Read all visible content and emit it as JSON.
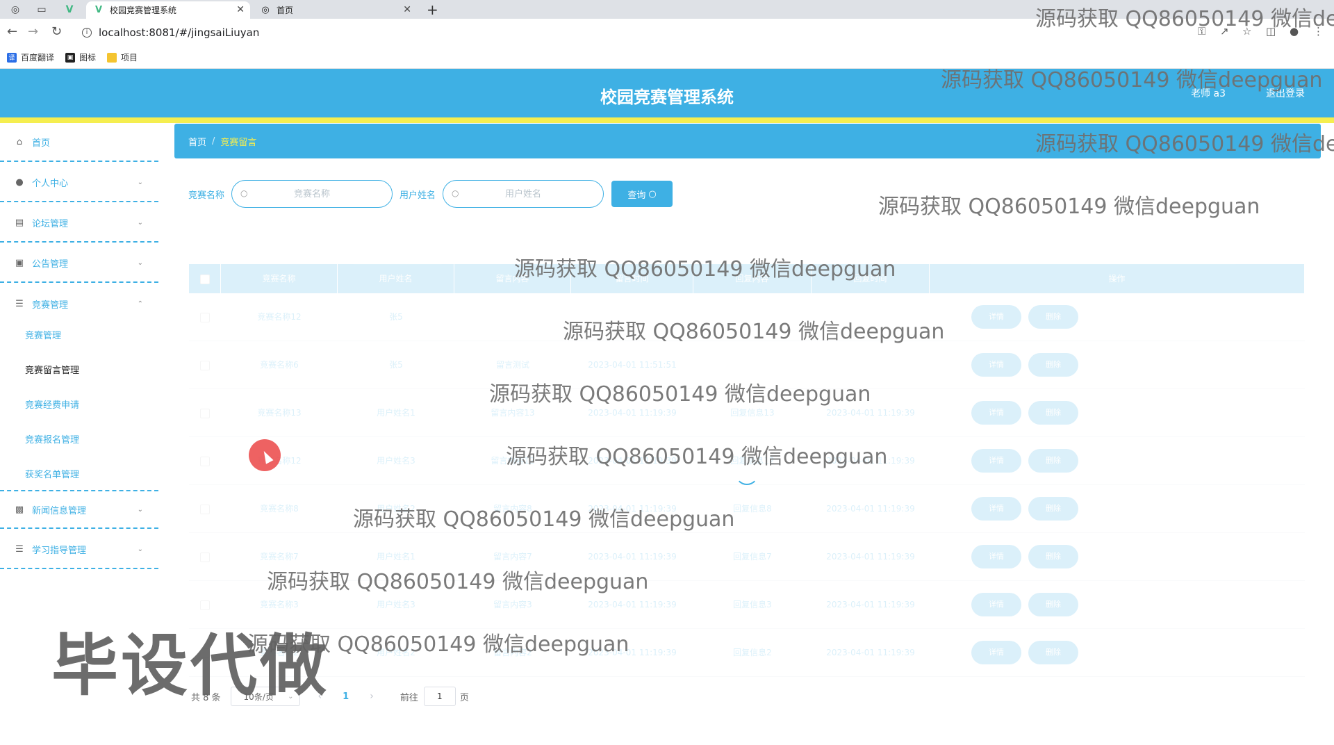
{
  "browser": {
    "tabs": [
      {
        "title": "校园竞赛管理系统",
        "active": true
      },
      {
        "title": "首页",
        "active": false
      }
    ],
    "url": "localhost:8081/#/jingsaiLiuyan",
    "bookmarks": [
      "百度翻译",
      "图标",
      "项目"
    ]
  },
  "header": {
    "title": "校园竞赛管理系统",
    "user": "老师 a3",
    "logout": "退出登录",
    "colors": {
      "primary": "#3eb0e4",
      "accent": "#f5ee4f"
    }
  },
  "sidebar": {
    "items": [
      {
        "label": "首页",
        "icon": "home-icon"
      },
      {
        "label": "个人中心",
        "icon": "user-icon"
      },
      {
        "label": "论坛管理",
        "icon": "forum-icon"
      },
      {
        "label": "公告管理",
        "icon": "briefcase-icon"
      },
      {
        "label": "竞赛管理",
        "icon": "menu-icon",
        "expanded": true
      },
      {
        "label": "新闻信息管理",
        "icon": "chat-icon"
      },
      {
        "label": "学习指导管理",
        "icon": "menu-icon"
      }
    ],
    "sub_items": [
      "竞赛管理",
      "竞赛留言管理",
      "竞赛经费申请",
      "竞赛报名管理",
      "获奖名单管理"
    ],
    "active_sub": "竞赛留言管理"
  },
  "breadcrumb": [
    "首页",
    "竞赛留言"
  ],
  "search": {
    "fields": [
      {
        "label": "竞赛名称",
        "placeholder": "竞赛名称",
        "value": ""
      },
      {
        "label": "用户姓名",
        "placeholder": "用户姓名",
        "value": ""
      }
    ],
    "button": "查询"
  },
  "table": {
    "loading": true,
    "columns": [
      "竞赛名称",
      "用户姓名",
      "留言内容",
      "留言时间",
      "回复内容",
      "回复时间",
      "操作"
    ],
    "rows": [
      {
        "name": "竞赛名称12",
        "user": "张5",
        "content": "",
        "time": "",
        "reply": "",
        "reply_time": ""
      },
      {
        "name": "竞赛名称6",
        "user": "张5",
        "content": "留言测试",
        "time": "2023-04-01 11:51:51",
        "reply": "",
        "reply_time": ""
      },
      {
        "name": "竞赛名称13",
        "user": "用户姓名1",
        "content": "留言内容13",
        "time": "2023-04-01 11:19:39",
        "reply": "回复信息13",
        "reply_time": "2023-04-01 11:19:39"
      },
      {
        "name": "竞赛名称12",
        "user": "用户姓名3",
        "content": "留言内容12",
        "time": "2023-04-01 11:19:39",
        "reply": "回复信息12",
        "reply_time": "2023-04-01 11:19:39"
      },
      {
        "name": "竞赛名称8",
        "user": "用户姓名2",
        "content": "留言内容8",
        "time": "2023-04-01 11:19:39",
        "reply": "回复信息8",
        "reply_time": "2023-04-01 11:19:39"
      },
      {
        "name": "竞赛名称7",
        "user": "用户姓名1",
        "content": "留言内容7",
        "time": "2023-04-01 11:19:39",
        "reply": "回复信息7",
        "reply_time": "2023-04-01 11:19:39"
      },
      {
        "name": "竞赛名称3",
        "user": "用户姓名3",
        "content": "留言内容3",
        "time": "2023-04-01 11:19:39",
        "reply": "回复信息3",
        "reply_time": "2023-04-01 11:19:39"
      },
      {
        "name": "竞赛名称2",
        "user": "用户姓名2",
        "content": "留言内容2",
        "time": "2023-04-01 11:19:39",
        "reply": "回复信息2",
        "reply_time": "2023-04-01 11:19:39"
      }
    ],
    "actions": [
      "详情",
      "删除"
    ]
  },
  "pagination": {
    "total": "共 8 条",
    "page_size": "10条/页",
    "current": "1",
    "goto_prefix": "前往",
    "goto_value": "1",
    "goto_suffix": "页"
  },
  "overlay": {
    "watermark": "源码获取 QQ86050149 微信deepguan",
    "big_watermark": "毕设代做"
  }
}
